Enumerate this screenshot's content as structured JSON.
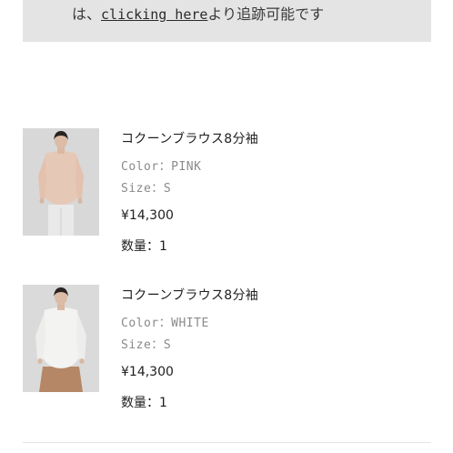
{
  "notice": {
    "prefix": "は、",
    "link_text": "clicking here",
    "suffix": "より追跡可能です"
  },
  "labels": {
    "color": "Color：",
    "size": "Size：",
    "quantity": "数量："
  },
  "items": [
    {
      "name": "コクーンブラウス8分袖",
      "color": "PINK",
      "size": "S",
      "price": "¥14,300",
      "quantity": "1"
    },
    {
      "name": "コクーンブラウス8分袖",
      "color": "WHITE",
      "size": "S",
      "price": "¥14,300",
      "quantity": "1"
    }
  ],
  "colors": {
    "notice_bg": "#e4e4e4",
    "photo_bg": "#d9d9d9",
    "pink_top": "#e6c8b6",
    "white_top": "#f3f3f1",
    "brown_pants": "#b58767",
    "light_pants": "#e9e9e9"
  }
}
